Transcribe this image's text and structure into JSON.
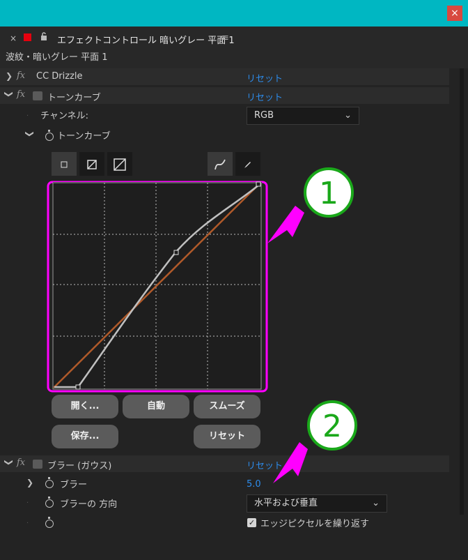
{
  "window": {
    "close_glyph": "×"
  },
  "panel": {
    "close_glyph": "×",
    "title": "エフェクトコントロール 暗いグレー 平面 1",
    "menu_glyph": "≡",
    "subtitle": "波紋・暗いグレー 平面 1"
  },
  "effects": {
    "cc_drizzle": {
      "name": "CC Drizzle",
      "reset": "リセット"
    },
    "tone_curve": {
      "name": "トーンカーブ",
      "reset": "リセット",
      "channel_label": "チャンネル:",
      "channel_value": "RGB",
      "curve_label": "トーンカーブ",
      "buttons": {
        "open": "開く...",
        "auto": "自動",
        "smooth": "スムーズ",
        "save": "保存...",
        "reset": "リセット"
      }
    },
    "blur": {
      "name": "ブラー (ガウス)",
      "reset": "リセット",
      "blur_label": "ブラー",
      "blur_value": "5.0",
      "direction_label": "ブラーの 方向",
      "direction_value": "水平および垂直",
      "repeat_label": "エッジピクセルを繰り返す"
    }
  },
  "annotations": {
    "one": "1",
    "two": "2"
  },
  "colors": {
    "accent_link": "#2d8ceb",
    "annotation_magenta": "#ff00ff",
    "annotation_green": "#1aa81a",
    "curve_diagonal": "#b05a2a"
  }
}
